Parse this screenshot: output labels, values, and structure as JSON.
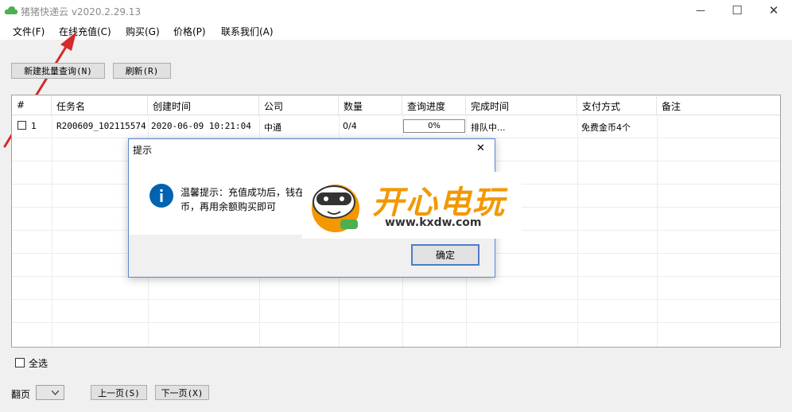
{
  "window": {
    "title": "猪猪快递云 v2020.2.29.13",
    "minimize": "—",
    "maximize": "☐",
    "close": "✕"
  },
  "menu": [
    "文件(F)",
    "在线充值(C)",
    "购买(G)",
    "价格(P)",
    "联系我们(A)"
  ],
  "toolbar": {
    "new_batch": "新建批量查询(N)",
    "refresh": "刷新(R)"
  },
  "table": {
    "headers": [
      "#",
      "任务名",
      "创建时间",
      "公司",
      "数量",
      "查询进度",
      "完成时间",
      "支付方式",
      "备注"
    ],
    "rows": [
      {
        "index": "1",
        "task_name": "R200609_102115574",
        "created": "2020-06-09 10:21:04",
        "company": "中通",
        "count": "0/4",
        "progress": "0%",
        "progress_value": 0,
        "finish": "排队中...",
        "payment": "免费金币4个",
        "note": ""
      }
    ]
  },
  "bottom": {
    "select_all": "全选",
    "page_label": "翻页",
    "prev": "上一页(S)",
    "next": "下一页(X)"
  },
  "dialog": {
    "title": "提示",
    "close": "✕",
    "message_line1": "温馨提示：充值成功后，钱在",
    "message_line2": "币，再用余额购买即可",
    "ok": "确定"
  },
  "watermark": {
    "brand": "开心电玩",
    "url": "www.kxdw.com"
  },
  "colors": {
    "accent": "#0063b1",
    "arrow": "#d42a2a",
    "brand_orange": "#f39800",
    "logo_green": "#4caf50"
  }
}
